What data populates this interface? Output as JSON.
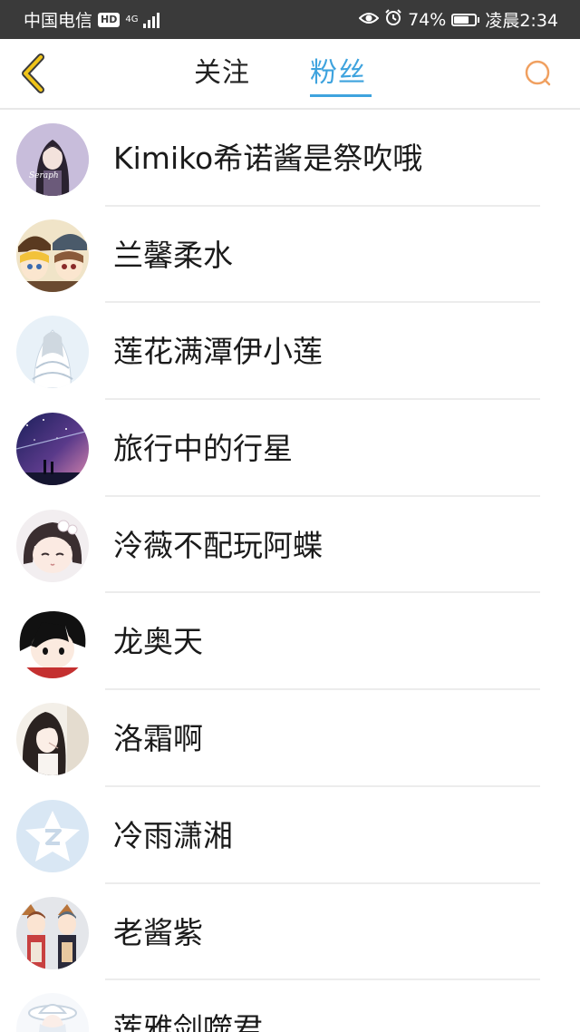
{
  "status_bar": {
    "carrier": "中国电信",
    "hd": "HD",
    "network": "4G",
    "battery": "74%",
    "battery_level": 0.74,
    "time": "凌晨2:34"
  },
  "header": {
    "tab_follow": "关注",
    "tab_fans": "粉丝",
    "active_tab": "粉丝",
    "accent_color": "#3ea3de",
    "back_color": "#e0a800",
    "search_color": "#f0a060"
  },
  "list": {
    "items": [
      {
        "name": "Kimiko希诺酱是祭吹哦",
        "avatar": "anime-girl-dark-hair-avatar"
      },
      {
        "name": "兰馨柔水",
        "avatar": "anime-duo-hats-avatar"
      },
      {
        "name": "莲花满潭伊小莲",
        "avatar": "anime-white-dress-avatar"
      },
      {
        "name": "旅行中的行星",
        "avatar": "starry-sky-avatar"
      },
      {
        "name": "泠薇不配玩阿蝶",
        "avatar": "chibi-girl-flower-avatar"
      },
      {
        "name": "龙奥天",
        "avatar": "chibi-black-hair-avatar"
      },
      {
        "name": "洛霜啊",
        "avatar": "sketch-girl-avatar"
      },
      {
        "name": "冷雨潇湘",
        "avatar": "default-qq-avatar"
      },
      {
        "name": "老酱紫",
        "avatar": "anime-duo-kimono-avatar"
      },
      {
        "name": "莲雅剑噬君",
        "avatar": "anime-white-hat-avatar"
      }
    ]
  }
}
